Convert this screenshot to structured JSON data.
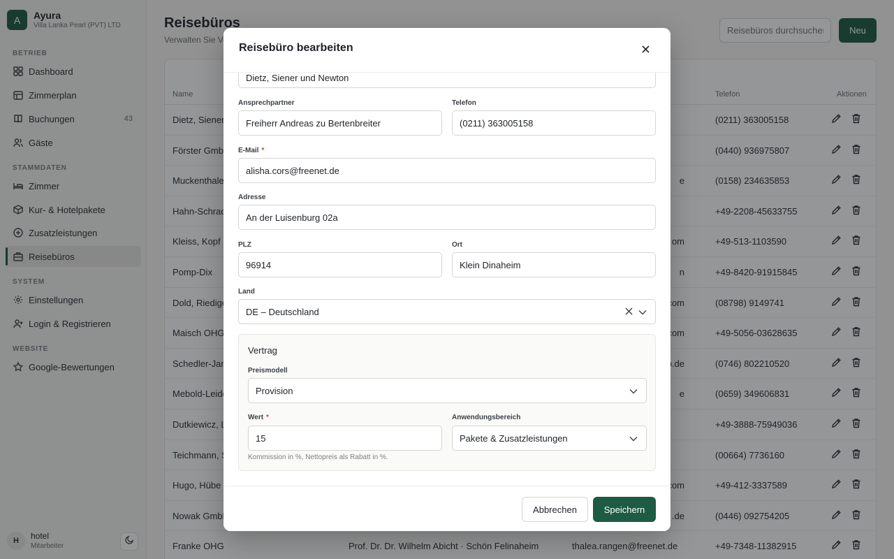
{
  "brand": {
    "logo_letter": "A",
    "name": "Ayura",
    "subtitle": "Villa Lanka Pearl (PVT) LTD"
  },
  "sidebar": {
    "sections": {
      "betrieb": "BETRIEB",
      "stammdaten": "STAMMDATEN",
      "system": "SYSTEM",
      "website": "WEBSITE"
    },
    "items": [
      {
        "label": "Dashboard",
        "icon": "grid-icon"
      },
      {
        "label": "Zimmerplan",
        "icon": "calendar-grid-icon"
      },
      {
        "label": "Buchungen",
        "icon": "book-icon",
        "badge": "43"
      },
      {
        "label": "Gäste",
        "icon": "users-icon"
      },
      {
        "label": "Zimmer",
        "icon": "bed-icon"
      },
      {
        "label": "Kur- & Hotelpakete",
        "icon": "package-icon"
      },
      {
        "label": "Zusatzleistungen",
        "icon": "plus-circle-icon"
      },
      {
        "label": "Reisebüros",
        "icon": "building-icon",
        "active": true
      },
      {
        "label": "Einstellungen",
        "icon": "gear-icon"
      },
      {
        "label": "Login & Registrieren",
        "icon": "user-plus-icon"
      },
      {
        "label": "Google-Bewertungen",
        "icon": "star-icon"
      }
    ],
    "user": {
      "initial": "H",
      "name": "hotel",
      "role": "Mitarbeiter"
    }
  },
  "page": {
    "title": "Reisebüros",
    "subtitle": "Verwalten Sie Ve",
    "search_placeholder": "Reisebüros durchsuchen",
    "new_button": "Neu"
  },
  "table": {
    "headers": {
      "name": "Name",
      "telefon": "Telefon",
      "aktionen": "Aktionen"
    },
    "rows": [
      {
        "name": "Dietz, Siener",
        "email": "",
        "phone": "(0211) 363005158"
      },
      {
        "name": "Förster GmbH",
        "email": "",
        "phone": "(0440) 936975807"
      },
      {
        "name": "Muckenthale",
        "email": "e",
        "phone": "(0158) 234635853"
      },
      {
        "name": "Hahn-Schrad",
        "email": "",
        "phone": "+49-2208-45633755"
      },
      {
        "name": "Kleiss, Kopf u",
        "email": "om",
        "phone": "+49-513-1103590"
      },
      {
        "name": "Pomp-Dix",
        "email": "n",
        "phone": "+49-8420-91915845"
      },
      {
        "name": "Dold, Riedige",
        "email": "com",
        "phone": "(08798) 9149741"
      },
      {
        "name": "Maisch OHG",
        "email": "com",
        "phone": "+49-5056-03628635"
      },
      {
        "name": "Schedler-Jan",
        "email": "b.de",
        "phone": "(0746) 802210520"
      },
      {
        "name": "Mebold-Leide",
        "email": "e",
        "phone": "(0659) 349606831"
      },
      {
        "name": "Dutkiewicz, L",
        "email": "",
        "phone": "+49-3888-75949036"
      },
      {
        "name": "Teichmann, S",
        "email": "",
        "phone": "(00664) 7736160"
      },
      {
        "name": "Hugo, Hübe",
        "email": ".com",
        "phone": "+49-412-3337589"
      },
      {
        "name": "Nowak GmbH",
        "email": ".de",
        "phone": "(0446) 092754205"
      },
      {
        "name": "Franke OHG",
        "contact": "Prof. Dr. Dr. Wilhelm Abicht · Schön Felinaheim",
        "email": "thalea.rangen@freenet.de",
        "phone": "+49-7348-11382915"
      }
    ]
  },
  "modal": {
    "title": "Reisebüro bearbeiten",
    "fields": {
      "name_value": "Dietz, Siener und Newton",
      "ansprechpartner_label": "Ansprechpartner",
      "ansprechpartner_value": "Freiherr Andreas zu Bertenbreiter",
      "telefon_label": "Telefon",
      "telefon_value": "(0211) 363005158",
      "email_label": "E-Mail",
      "email_value": "alisha.cors@freenet.de",
      "adresse_label": "Adresse",
      "adresse_value": "An der Luisenburg 02a",
      "plz_label": "PLZ",
      "plz_value": "96914",
      "ort_label": "Ort",
      "ort_value": "Klein Dinaheim",
      "land_label": "Land",
      "land_value": "DE – Deutschland",
      "required_mark": "*"
    },
    "vertrag": {
      "title": "Vertrag",
      "preismodell_label": "Preismodell",
      "preismodell_value": "Provision",
      "wert_label": "Wert",
      "wert_value": "15",
      "anwendung_label": "Anwendungsbereich",
      "anwendung_value": "Pakete & Zusatzleistungen",
      "hint": "Kommission in %, Nettopreis als Rabatt in %."
    },
    "buttons": {
      "cancel": "Abbrechen",
      "save": "Speichern"
    }
  },
  "colors": {
    "brand": "#1d5b43",
    "required": "#d23b3b"
  }
}
